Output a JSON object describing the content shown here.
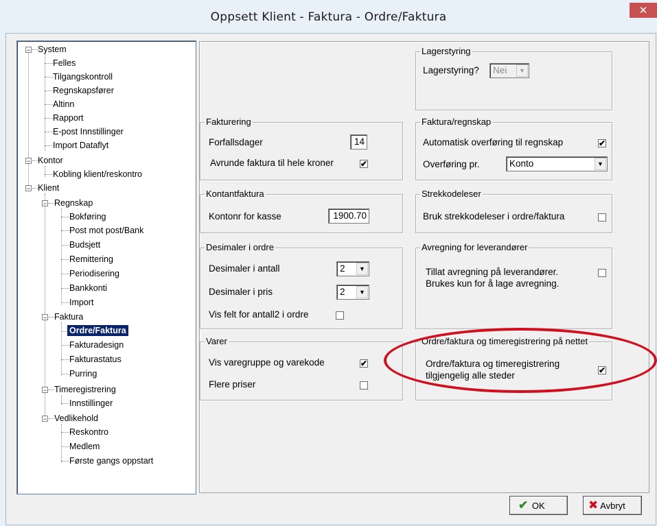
{
  "window": {
    "title": "Oppsett   Klient - Faktura - Ordre/Faktura",
    "close_glyph": "✕"
  },
  "tree": {
    "system": "System",
    "felles": "Felles",
    "tilgangskontroll": "Tilgangskontroll",
    "regnskapsforer": "Regnskapsfører",
    "altinn": "Altinn",
    "rapport": "Rapport",
    "epost": "E-post Innstillinger",
    "import_dataflyt": "Import Dataflyt",
    "kontor": "Kontor",
    "kobling": "Kobling klient/reskontro",
    "klient": "Klient",
    "regnskap": "Regnskap",
    "bokforing": "Bokføring",
    "post_mot_post": "Post mot post/Bank",
    "budsjett": "Budsjett",
    "remittering": "Remittering",
    "periodisering": "Periodisering",
    "bankkonti": "Bankkonti",
    "import": "Import",
    "faktura": "Faktura",
    "ordre_faktura": "Ordre/Faktura",
    "fakturadesign": "Fakturadesign",
    "fakturastatus": "Fakturastatus",
    "purring": "Purring",
    "timeregistrering": "Timeregistrering",
    "innstillinger": "Innstillinger",
    "vedlikehold": "Vedlikehold",
    "reskontro": "Reskontro",
    "medlem": "Medlem",
    "forste_gangs": "Første gangs oppstart",
    "expanded_glyph": "−"
  },
  "lagerstyring": {
    "title": "Lagerstyring",
    "label": "Lagerstyring?",
    "value": "Nei"
  },
  "fakturering": {
    "title": "Fakturering",
    "forfallsdager_label": "Forfallsdager",
    "forfallsdager_value": "14",
    "avrunde_label": "Avrunde faktura til hele kroner",
    "avrunde_checked": "✔"
  },
  "regnskap_group": {
    "title": "Faktura/regnskap",
    "auto_label": "Automatisk overføring til regnskap",
    "auto_checked": "✔",
    "overforing_label": "Overføring pr.",
    "overforing_value": "Konto"
  },
  "kontantfaktura": {
    "title": "Kontantfaktura",
    "label": "Kontonr for kasse",
    "value": "1900.70"
  },
  "strekkode": {
    "title": "Strekkodeleser",
    "label": "Bruk strekkodeleser i ordre/faktura"
  },
  "desimaler": {
    "title": "Desimaler i ordre",
    "antall_label": "Desimaler i antall",
    "antall_value": "2",
    "pris_label": "Desimaler i pris",
    "pris_value": "2",
    "vis_label": "Vis felt for antall2 i ordre"
  },
  "avregning": {
    "title": "Avregning for leverandører",
    "line1": "Tillat avregning på leverandører.",
    "line2": "Brukes kun for å lage avregning."
  },
  "varer": {
    "title": "Varer",
    "vis_label": "Vis varegruppe og varekode",
    "vis_checked": "✔",
    "flere_label": "Flere priser"
  },
  "nettet": {
    "title": "Ordre/faktura og timeregistrering på nettet",
    "line1": "Ordre/faktura og timeregistrering",
    "line2": "tilgjengelig alle steder",
    "checked": "✔"
  },
  "buttons": {
    "ok": "OK",
    "ok_icon": "✔",
    "cancel": "Avbryt",
    "cancel_icon": "✖"
  },
  "colors": {
    "selection": "#0a246a",
    "annotation": "#d0101e",
    "ok_green": "#2e8b2e",
    "cancel_red": "#d0101e"
  }
}
